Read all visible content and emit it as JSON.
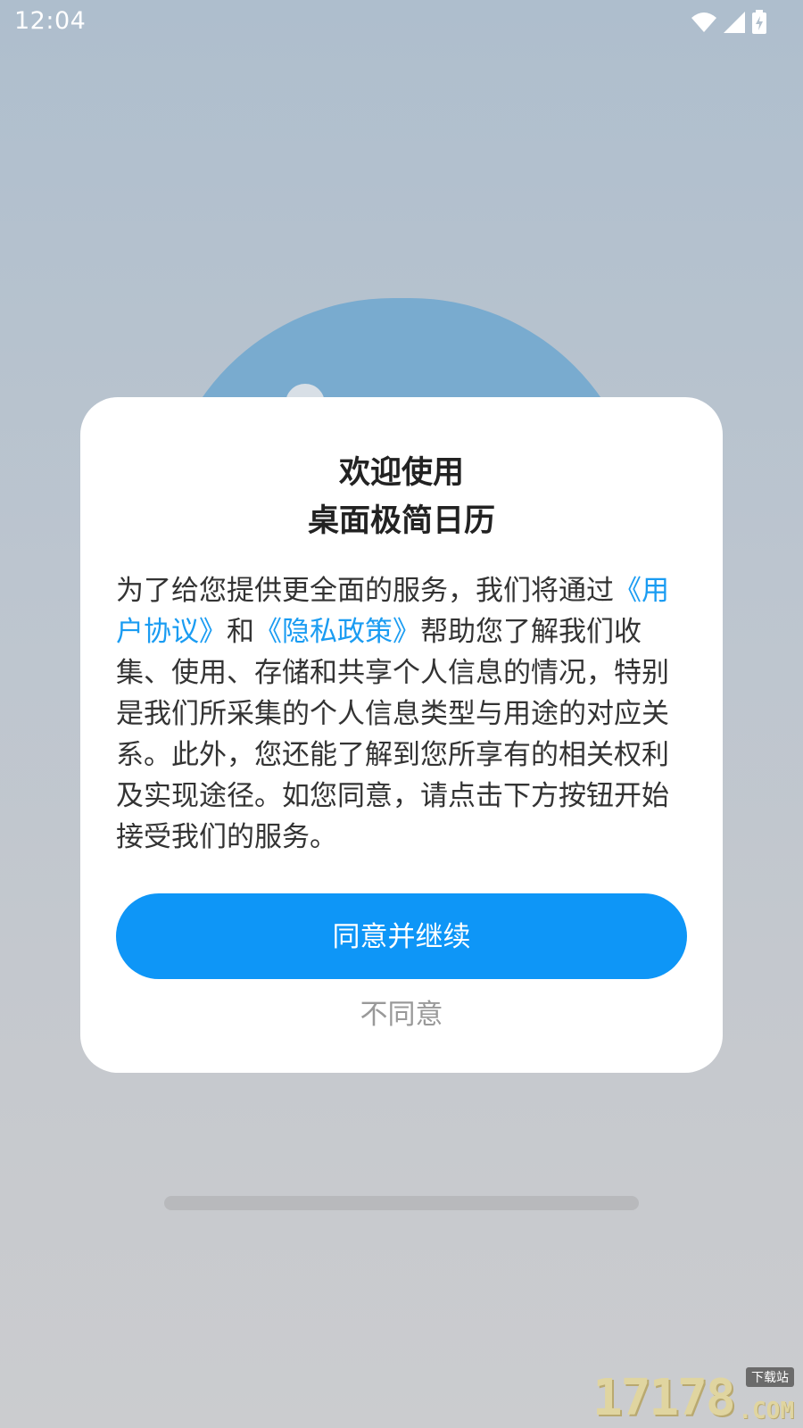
{
  "status_bar": {
    "time": "12:04",
    "icons": [
      "wifi-icon",
      "signal-icon",
      "battery-charging-icon"
    ]
  },
  "dialog": {
    "title_line1": "欢迎使用",
    "title_line2": "桌面极简日历",
    "body": {
      "text1": "为了给您提供更全面的服务，我们将通过",
      "link_user_agreement": "《用户协议》",
      "text2": "和",
      "link_privacy_policy": "《隐私政策》",
      "text3": "帮助您了解我们收集、使用、存储和共享个人信息的情况，特别是我们所采集的个人信息类型与用途的对应关系。此外，您还能了解到您所享有的相关权利及实现途径。如您同意，请点击下方按钮开始接受我们的服务。"
    },
    "agree_label": "同意并继续",
    "disagree_label": "不同意"
  },
  "watermark": {
    "digits": "17178",
    "tag": "下载站",
    "suffix": ".COM"
  },
  "colors": {
    "accent": "#0e96f7",
    "link": "#1a9cf2",
    "background_dome": "#79abcf"
  }
}
